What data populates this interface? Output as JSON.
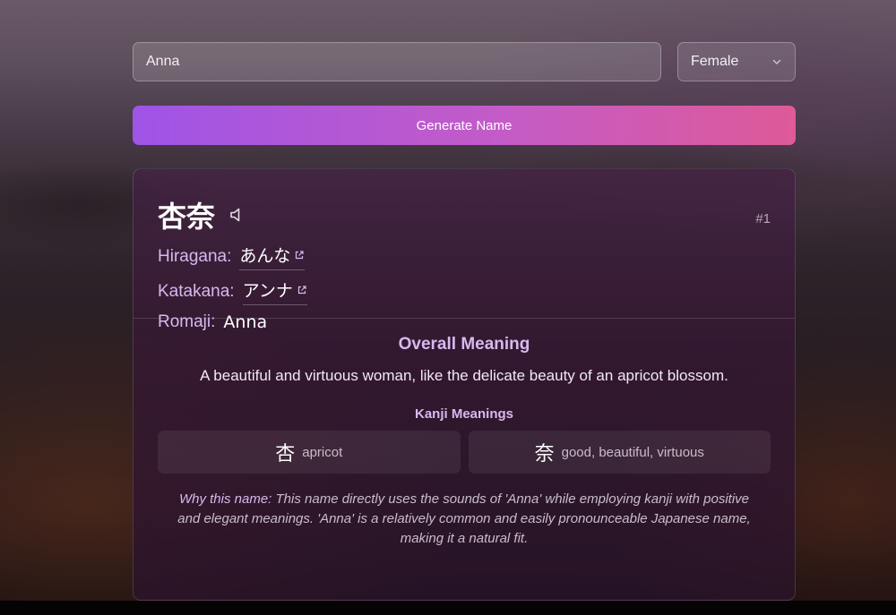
{
  "form": {
    "name_value": "Anna",
    "gender_selected": "Female"
  },
  "generate_label": "Generate Name",
  "result": {
    "kanji": "杏奈",
    "index": "#1",
    "hiragana_label": "Hiragana:",
    "hiragana": "あんな",
    "katakana_label": "Katakana:",
    "katakana": "アンナ",
    "romaji_label": "Romaji:",
    "romaji": "Anna",
    "overall_title": "Overall Meaning",
    "overall_text": "A beautiful and virtuous woman, like the delicate beauty of an apricot blossom.",
    "kanji_meanings_title": "Kanji Meanings",
    "kanji_meanings": [
      {
        "kanji": "杏",
        "meaning": "apricot"
      },
      {
        "kanji": "奈",
        "meaning": "good, beautiful, virtuous"
      }
    ],
    "why_label": "Why this name:",
    "why_text": "This name directly uses the sounds of 'Anna' while employing kanji with positive and elegant meanings. 'Anna' is a relatively common and easily pronounceable Japanese name, making it a natural fit."
  },
  "colors": {
    "accent_text": "#d9b8ee",
    "button_gradient_start": "#9f54e6",
    "button_gradient_end": "#de5a98"
  },
  "icons": {
    "speaker": "speaker-icon",
    "external_link": "external-link-icon",
    "chevron": "chevron-down-icon"
  }
}
